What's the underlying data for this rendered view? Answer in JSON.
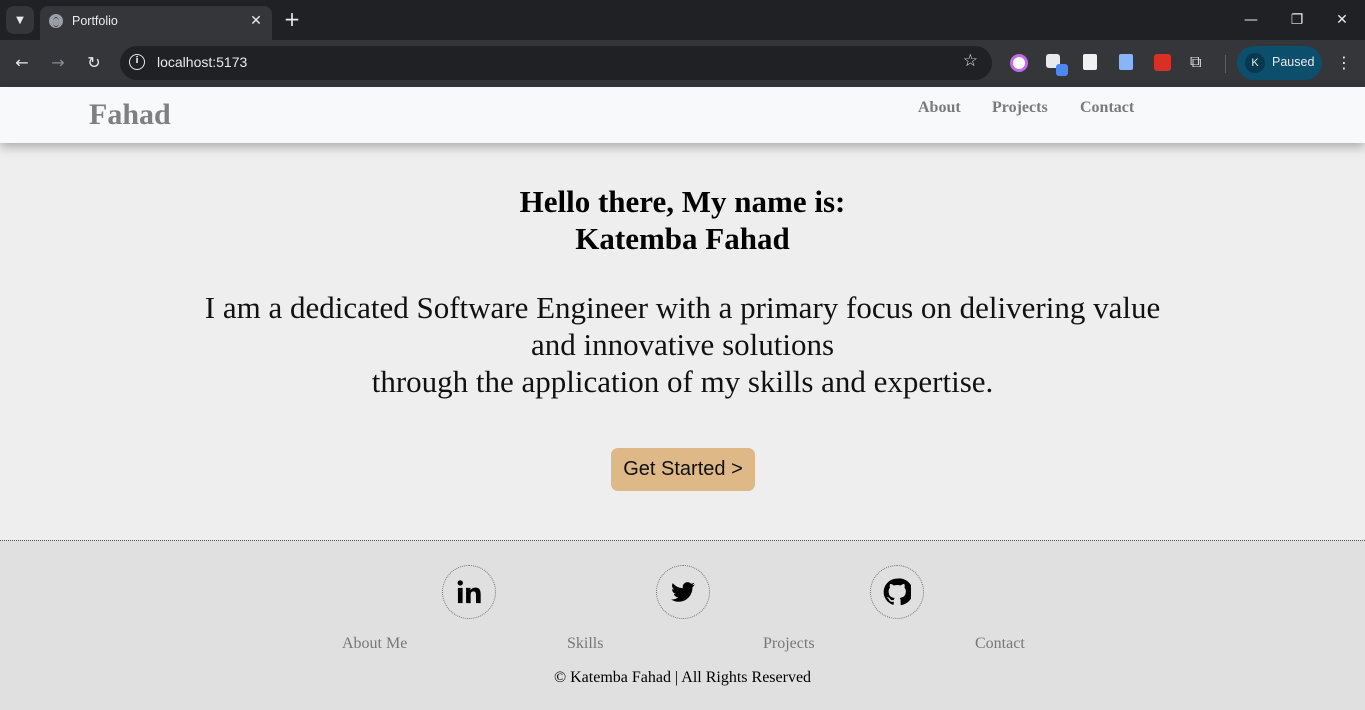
{
  "browser": {
    "tab": {
      "title": "Portfolio"
    },
    "new_tab": "+",
    "address_bar": {
      "url": "localhost:5173"
    },
    "profile": {
      "initial": "K",
      "status": "Paused"
    },
    "window_controls": {
      "minimize": "—",
      "restore": "❐",
      "close": "✕"
    }
  },
  "header": {
    "logo": "Fahad",
    "nav": [
      "About",
      "Projects",
      "Contact"
    ]
  },
  "hero": {
    "greeting_line1": "Hello there, My name is:",
    "greeting_line2": "Katemba Fahad",
    "intro_line1": "I am a dedicated Software Engineer with a primary focus on delivering value and innovative solutions",
    "intro_line2": "through the application of my skills and expertise.",
    "cta_label": "Get Started >"
  },
  "footer": {
    "social": [
      {
        "name": "linkedin-icon"
      },
      {
        "name": "twitter-icon"
      },
      {
        "name": "github-icon"
      }
    ],
    "links": [
      "About Me",
      "Skills",
      "Projects",
      "Contact"
    ],
    "copyright": "© Katemba Fahad | All Rights Reserved"
  },
  "colors": {
    "cta_background": "#deb887",
    "header_background": "#f8f9fb",
    "page_background": "#eeeeee",
    "footer_background": "#e0e0e0",
    "browser_profile": "#0b4f6c"
  }
}
